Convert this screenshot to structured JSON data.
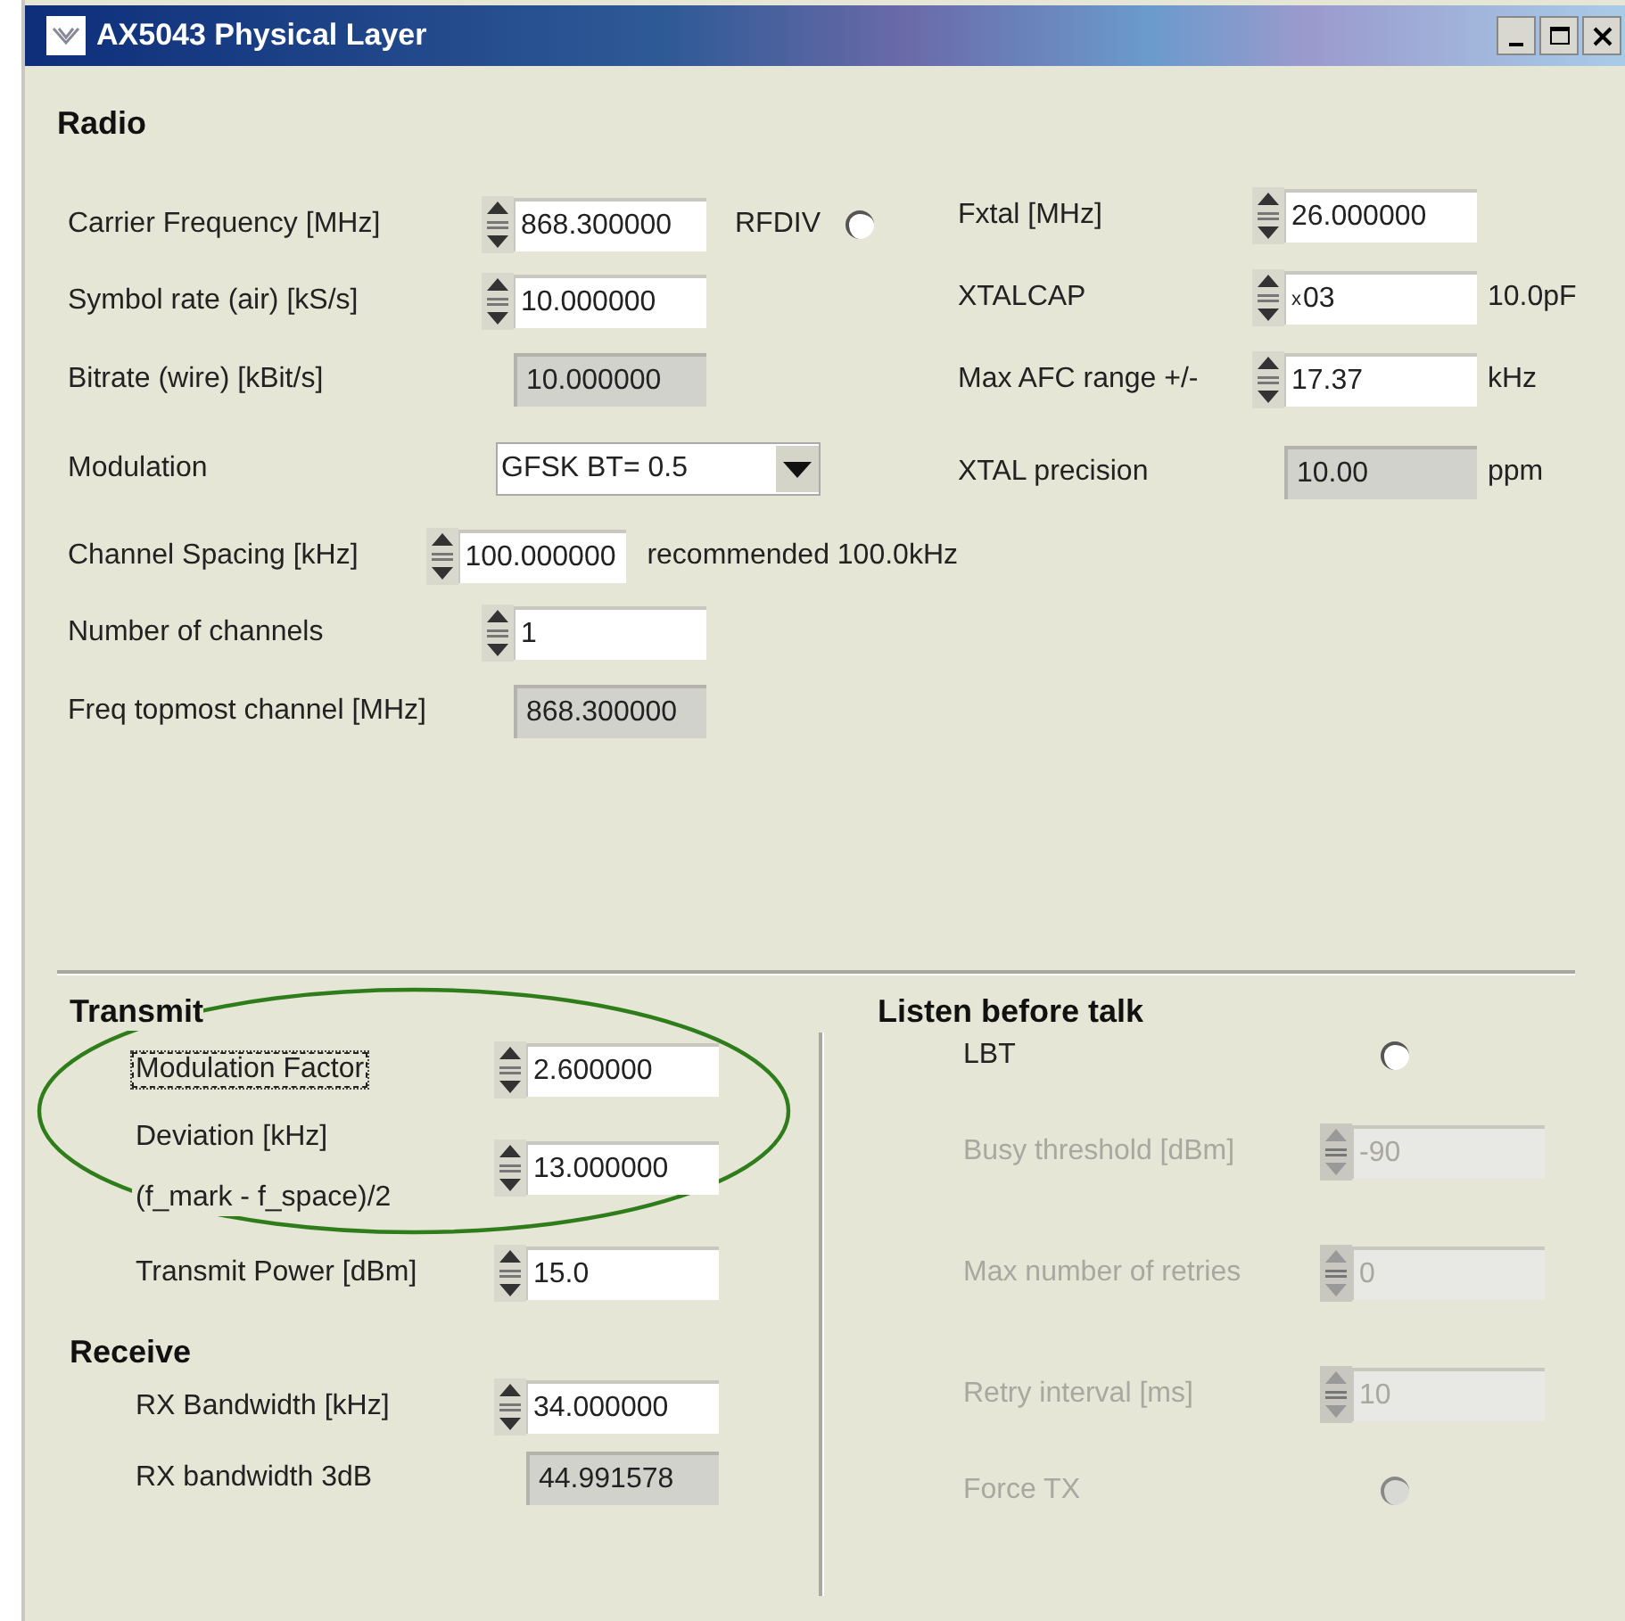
{
  "window": {
    "title": "AX5043 Physical Layer"
  },
  "radio": {
    "heading": "Radio",
    "left": [
      {
        "kind": "numeric",
        "label": "Carrier Frequency [MHz]",
        "value": "868.300000",
        "toggle": {
          "label": "RFDIV",
          "on": false
        }
      },
      {
        "kind": "numeric",
        "label": "Symbol rate (air) [kS/s]",
        "value": "10.000000"
      },
      {
        "kind": "indicator",
        "label": "Bitrate (wire) [kBit/s]",
        "value": "10.000000"
      },
      {
        "kind": "dropdown",
        "label": "Modulation",
        "value": "GFSK BT= 0.5"
      },
      {
        "kind": "numeric",
        "label": "Channel Spacing [kHz]",
        "value": "100.000000",
        "note": "recommended 100.0kHz"
      },
      {
        "kind": "numeric",
        "label": "Number of channels",
        "value": "1"
      },
      {
        "kind": "indicator",
        "label": "Freq topmost channel [MHz]",
        "value": "868.300000"
      }
    ],
    "right": [
      {
        "kind": "numeric",
        "label": "Fxtal [MHz]",
        "value": "26.000000"
      },
      {
        "kind": "numeric",
        "label": "XTALCAP",
        "radix": "x",
        "value": "03",
        "unit": "10.0pF"
      },
      {
        "kind": "numeric",
        "label": "Max AFC range +/-",
        "value": "17.37",
        "unit": "kHz"
      },
      {
        "kind": "indicator",
        "label": "XTAL precision",
        "value": "10.00",
        "unit": "ppm"
      }
    ]
  },
  "transmit": {
    "heading": "Transmit",
    "highlight": {
      "kind": "ellipse"
    },
    "rows": [
      {
        "kind": "numeric",
        "label": "Modulation Factor",
        "value": "2.600000",
        "focused": true
      },
      {
        "kind": "numeric",
        "label": "Deviation [kHz]",
        "sublabel": "(f_mark - f_space)/2",
        "value": "13.000000",
        "focused": false
      },
      {
        "kind": "numeric",
        "label": "Transmit Power [dBm]",
        "value": "15.0",
        "focused": false
      }
    ]
  },
  "receive": {
    "heading": "Receive",
    "rows": [
      {
        "kind": "numeric",
        "label": "RX Bandwidth [kHz]",
        "value": "34.000000"
      },
      {
        "kind": "indicator",
        "label": "RX bandwidth 3dB",
        "value": "44.991578"
      }
    ]
  },
  "listen_before_talk": {
    "heading": "Listen before talk",
    "rows": [
      {
        "kind": "toggle",
        "label": "LBT",
        "on": false,
        "disabled": false
      },
      {
        "kind": "numeric",
        "label": "Busy threshold [dBm]",
        "value": "-90",
        "disabled": true
      },
      {
        "kind": "numeric",
        "label": "Max number of retries",
        "value": "0",
        "disabled": true
      },
      {
        "kind": "numeric",
        "label": "Retry interval [ms]",
        "value": "10",
        "disabled": true
      },
      {
        "kind": "toggle",
        "label": "Force TX",
        "on": false,
        "disabled": true
      }
    ]
  }
}
